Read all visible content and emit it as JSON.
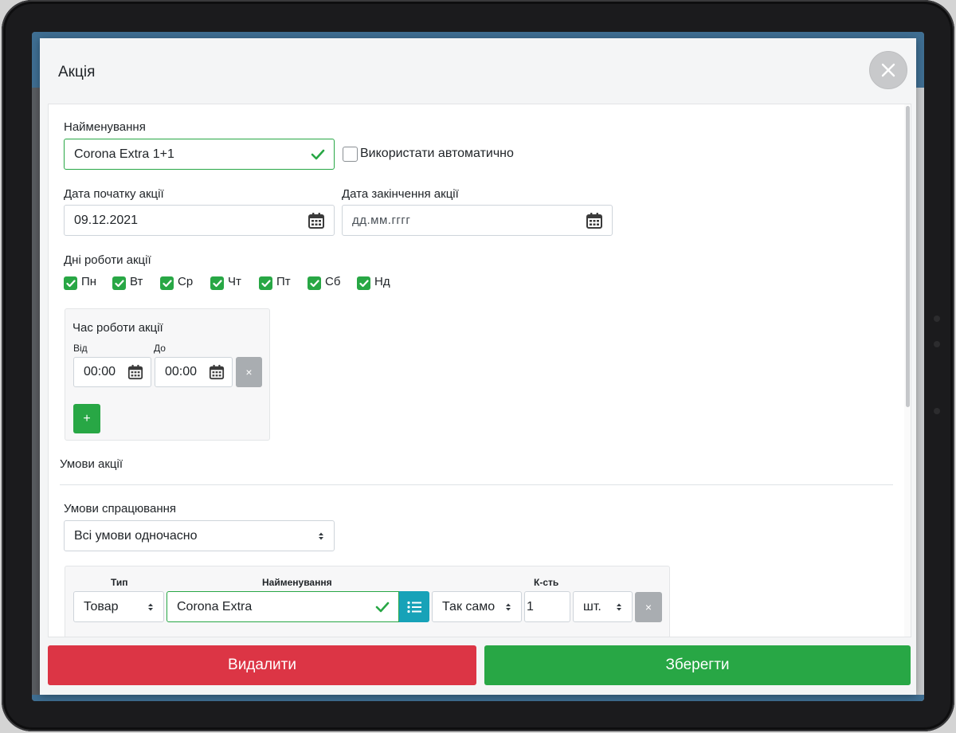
{
  "modal": {
    "title": "Акція",
    "close_label": "×"
  },
  "form": {
    "name_label": "Найменування",
    "name_value": "Corona Extra 1+1",
    "auto_label": "Використати автоматично",
    "start_date_label": "Дата початку акції",
    "start_date_value": "09.12.2021",
    "end_date_label": "Дата закінчення акції",
    "end_date_placeholder": "дд.мм.гггг",
    "days_label": "Дні роботи акції",
    "days": [
      {
        "label": "Пн",
        "checked": true
      },
      {
        "label": "Вт",
        "checked": true
      },
      {
        "label": "Ср",
        "checked": true
      },
      {
        "label": "Чт",
        "checked": true
      },
      {
        "label": "Пт",
        "checked": true
      },
      {
        "label": "Сб",
        "checked": true
      },
      {
        "label": "Нд",
        "checked": true
      }
    ],
    "time": {
      "title": "Час роботи акції",
      "from_label": "Від",
      "to_label": "До",
      "from_value": "00:00",
      "to_value": "00:00",
      "remove_label": "×",
      "add_label": "+"
    }
  },
  "conditions": {
    "section_title": "Умови акції",
    "trigger_label": "Умови спрацювання",
    "trigger_value": "Всі умови одночасно",
    "columns": {
      "type": "Тип",
      "name": "Найменування",
      "qty": "К-сть"
    },
    "row": {
      "type_value": "Товар",
      "name_value": "Corona Extra",
      "mode_value": "Так само",
      "qty_value": "1",
      "unit_value": "шт.",
      "remove_label": "×"
    }
  },
  "footer": {
    "delete_label": "Видалити",
    "save_label": "Зберегти"
  },
  "colors": {
    "success": "#28a745",
    "danger": "#dc3545",
    "info": "#17a2b8",
    "secondary": "#a9adb1"
  }
}
